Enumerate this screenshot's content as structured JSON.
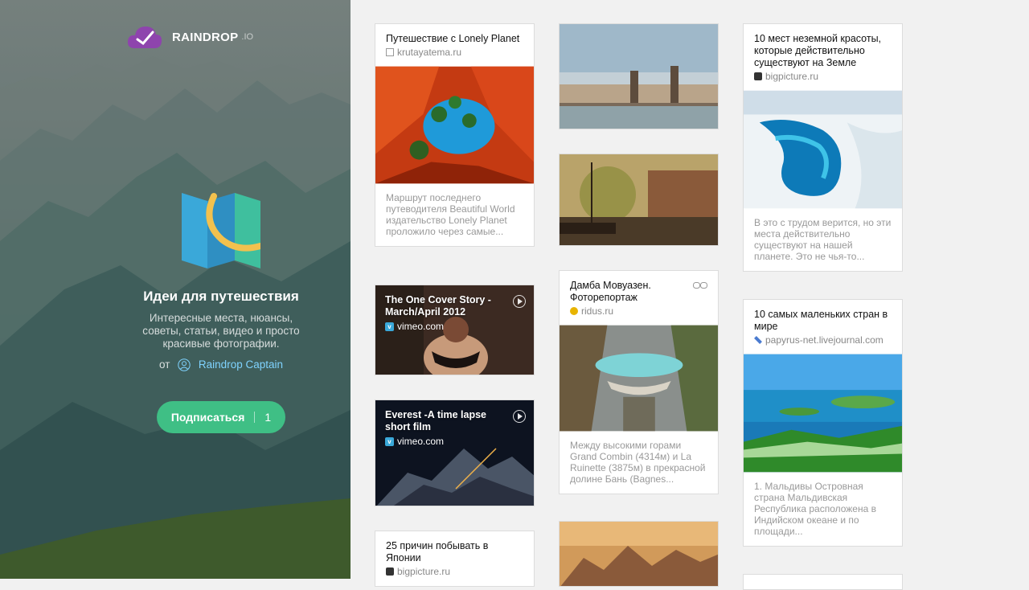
{
  "sidebar": {
    "logo_text": "RAINDROP",
    "logo_suffix": ".IO",
    "collection_title": "Идеи для путешествия",
    "collection_description": "Интересные места, нюансы, советы, статьи, видео и просто красивые фотографии.",
    "author_prefix": "от",
    "author_name": "Raindrop Captain",
    "subscribe_label": "Подписаться",
    "subscribe_count": "1",
    "accent_color": "#3fbf85"
  },
  "bookmarks": {
    "col1": [
      {
        "title": "Путешествие с Lonely Planet",
        "source": "krutayatema.ru",
        "excerpt": "Маршрут последнего путеводителя Beautiful World издательство Lonely Planet проложило через самые..."
      },
      {
        "title": "The One Cover Story - March/April 2012",
        "source": "vimeo.com"
      },
      {
        "title": "Everest -A time lapse short film",
        "source": "vimeo.com"
      },
      {
        "title": "25 причин побывать в Японии",
        "source": "bigpicture.ru"
      }
    ],
    "col2": [
      {
        "title": "Дамба Мовуазен. Фоторепортаж",
        "source": "ridus.ru",
        "excerpt": "Между высокими горами Grand Combin (4314м) и La Ruinette (3875м) в прекрасной долине Бань (Bagnes..."
      }
    ],
    "col3": [
      {
        "title": "10 мест неземной красоты, которые действительно существуют на Земле",
        "source": "bigpicture.ru",
        "excerpt": "В это с трудом верится, но эти места действительно существуют на нашей планете. Это не чья-то..."
      },
      {
        "title": "10 самых маленьких стран в мире",
        "source": "papyrus-net.livejournal.com",
        "excerpt": "1. Мальдивы Островная страна Мальдивская Республика расположена в Индийском океане и по площади..."
      }
    ]
  }
}
